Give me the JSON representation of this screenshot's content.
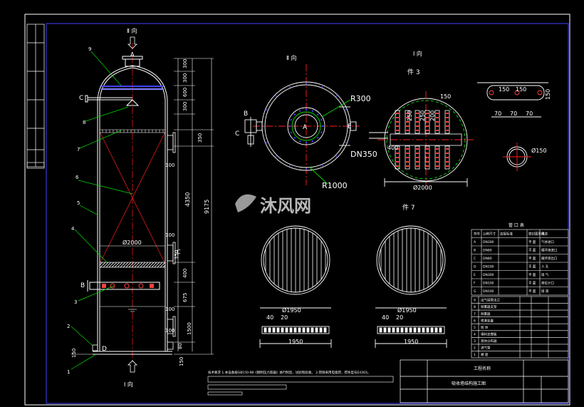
{
  "views": {
    "view_ii_top": "Ⅱ 向",
    "view_i_bottom": "Ⅰ 向",
    "view_ii_side": "Ⅱ 向",
    "view_i_side": "Ⅰ 向",
    "part3_title": "件   3",
    "part7_title": "件   7"
  },
  "nozzles": {
    "A": "A",
    "B": "B",
    "C": "C",
    "D": "D",
    "E": "E"
  },
  "leaders": [
    "9",
    "8",
    "7",
    "6",
    "5",
    "4",
    "3",
    "2",
    "1"
  ],
  "dimensions": {
    "d300a": "300",
    "d300b": "300",
    "d600": "600",
    "d300c": "300",
    "d350": "350",
    "d4350": "4350",
    "d9175": "9175",
    "d400": "400",
    "d675": "675",
    "d1500": "1500",
    "d150_bottom": "150",
    "d150_foot": "150",
    "d100a": "100",
    "d100b": "100",
    "d100c": "100",
    "d100d": "100",
    "d80": "80",
    "d350b": "350",
    "dia2000": "Ø2000"
  },
  "plan": {
    "r300": "R300",
    "r1000": "R1000",
    "dn350": "DN350"
  },
  "part3": {
    "dia2000": "Ø2000",
    "d400": "400",
    "d150": "150",
    "d250a": "250",
    "d250b": "250",
    "d200": "200"
  },
  "part7": {
    "left_dia": "Ø1950",
    "right_dia": "Ø1950",
    "left_40": "40",
    "left_20": "20",
    "right_40": "40",
    "right_20": "20",
    "left_len": "1950",
    "right_len": "1950"
  },
  "detail": {
    "d150a": "150",
    "d150b": "150",
    "d150c": "150",
    "d70a": "70",
    "d70b": "70",
    "d70c": "70",
    "dia150": "Ø150"
  },
  "watermark": "沐风网",
  "nozzle_table": {
    "title": "管 口 表",
    "headers": [
      "符号",
      "公称尺寸",
      "连接标准",
      "密封面形式",
      "用途"
    ],
    "rows": [
      [
        "A",
        "DN300",
        "",
        "平 面",
        "气体进口"
      ],
      [
        "B",
        "DN80",
        "",
        "平 面",
        "循环液进口"
      ],
      [
        "C",
        "DN80",
        "",
        "平 面",
        "循环液出口"
      ],
      [
        "D",
        "DN100",
        "",
        "平 面",
        "人 孔"
      ],
      [
        "E",
        "DN300",
        "",
        "平 面",
        "排 气"
      ],
      [
        "F",
        "DN100",
        "",
        "平 面",
        "液位计口"
      ],
      [
        "G",
        "DN100",
        "",
        "平 面",
        "排 液"
      ]
    ]
  },
  "parts_list": {
    "rows": [
      [
        "9",
        "出气接管法兰"
      ],
      [
        "8",
        "除雾器支架"
      ],
      [
        "7",
        "除雾器"
      ],
      [
        "6",
        "喷淋装置"
      ],
      [
        "5",
        "筒 体"
      ],
      [
        "4",
        "填料支撑板"
      ],
      [
        "3",
        "液体分布器"
      ],
      [
        "2",
        "进气管"
      ],
      [
        "1",
        "裙 座"
      ]
    ]
  },
  "title_block": {
    "project": "工程名称",
    "drawing": "吸收塔结构施工图"
  },
  "notes": {
    "line1": "技术要求  1.本设备按GB150-98《钢制压力容器》进行制造、试验和验收。  2.焊接采用电弧焊，焊条型号E4303。"
  },
  "colors": {
    "background": "#000000",
    "frame": "#ffffff",
    "vessel": "#ffffff",
    "dimension": "#ffffff",
    "centerline": "#ff2020",
    "leader": "#00e000",
    "text_white": "#ffffff",
    "nozzle_fill": "#ff4040",
    "packing": "#7f7fff",
    "hatch": "#ffff60",
    "demister": "#4040ff"
  }
}
